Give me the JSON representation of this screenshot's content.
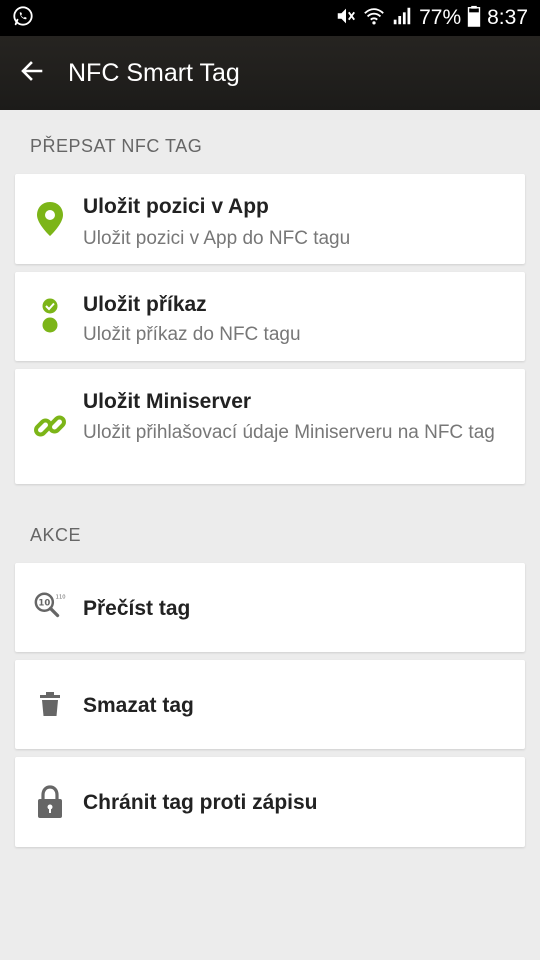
{
  "status_bar": {
    "battery_percent": "77%",
    "time": "8:37"
  },
  "app_bar": {
    "title": "NFC Smart Tag"
  },
  "sections": {
    "rewrite": {
      "header": "PŘEPSAT NFC TAG",
      "items": [
        {
          "title": "Uložit pozici v App",
          "subtitle": "Uložit pozici v App do NFC tagu",
          "icon": "location-pin-icon"
        },
        {
          "title": "Uložit příkaz",
          "subtitle": "Uložit příkaz do NFC tagu",
          "icon": "command-icon"
        },
        {
          "title": "Uložit Miniserver",
          "subtitle": "Uložit přihlašovací údaje Miniserveru na NFC tag",
          "icon": "link-icon"
        }
      ]
    },
    "actions": {
      "header": "AKCE",
      "items": [
        {
          "title": "Přečíst tag",
          "icon": "read-tag-icon"
        },
        {
          "title": "Smazat tag",
          "icon": "trash-icon"
        },
        {
          "title": "Chránit tag proti zápisu",
          "icon": "lock-icon"
        }
      ]
    }
  },
  "colors": {
    "accent_green": "#7cb518",
    "icon_gray": "#666666",
    "app_bar": "#1f1e1c",
    "background": "#ececec"
  }
}
